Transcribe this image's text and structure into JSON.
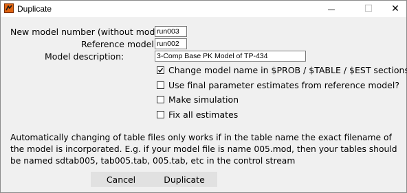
{
  "window": {
    "title": "Duplicate",
    "minimize_symbol": "—",
    "maximize_symbol": "☐",
    "close_symbol": "✕",
    "icon": "app-icon"
  },
  "form": {
    "new_model_label": "New model number (without mod):",
    "new_model_value": "run003",
    "reference_label": "Reference model:",
    "reference_value": "run002",
    "description_label": "Model description:",
    "description_value": "3-Comp Base PK Model of TP-434"
  },
  "options": [
    {
      "label": "Change model name in $PROB / $TABLE / $EST sections?",
      "checked": true
    },
    {
      "label": "Use final parameter estimates from reference model?",
      "checked": false
    },
    {
      "label": "Make simulation",
      "checked": false
    },
    {
      "label": "Fix all estimates",
      "checked": false
    }
  ],
  "info": {
    "line1": "Automatically changing of table files only works if in the table name the exact filename of",
    "line2": "the model is incorporated. E.g. if your model file is name 005.mod, then your tables should",
    "line3": "be named sdtab005, tab005.tab, 005.tab, etc in the control stream"
  },
  "buttons": {
    "cancel": "Cancel",
    "duplicate": "Duplicate"
  },
  "colors": {
    "window_bg": "#f0f0f0",
    "button_bg": "#e1e1e1",
    "icon_color": "#e06410"
  }
}
